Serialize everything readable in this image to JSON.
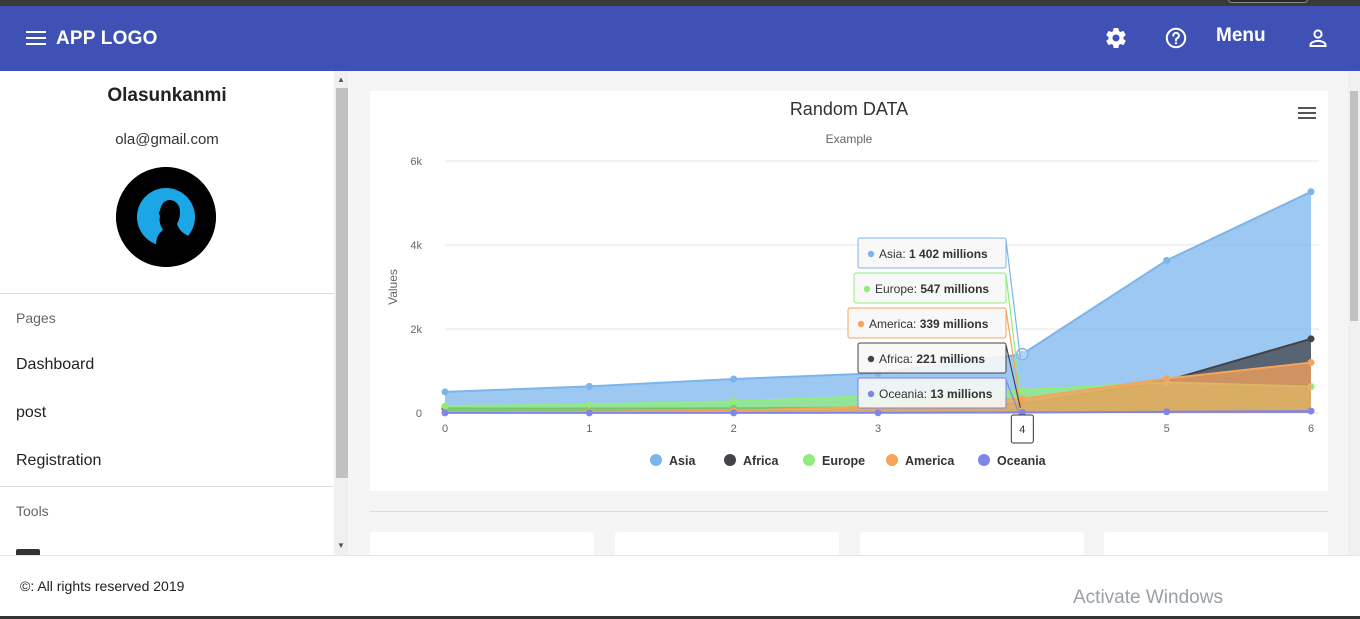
{
  "appbar": {
    "logo": "APP LOGO",
    "menu_label": "Menu",
    "icons": [
      "menu-icon",
      "gear-icon",
      "help-icon",
      "user-icon"
    ],
    "color": "#3f51b5"
  },
  "sidebar": {
    "user_name": "Olasunkanmi",
    "user_email": "ola@gmail.com",
    "sections": {
      "pages_title": "Pages",
      "pages": [
        {
          "label": "Dashboard"
        },
        {
          "label": "post"
        },
        {
          "label": "Registration"
        }
      ],
      "tools_title": "Tools"
    }
  },
  "chart_data": {
    "type": "area",
    "title": "Random DATA",
    "subtitle": "Example",
    "ylabel": "Values",
    "x": [
      0,
      1,
      2,
      3,
      4,
      5,
      6
    ],
    "ylim": [
      0,
      6000
    ],
    "yticks": [
      0,
      2000,
      4000,
      6000
    ],
    "ytick_labels": [
      "0",
      "2k",
      "4k",
      "6k"
    ],
    "grid": true,
    "legend_position": "bottom",
    "series": [
      {
        "name": "Asia",
        "color": "#7cb5ec",
        "values": [
          502,
          635,
          809,
          947,
          1402,
          3634,
          5268
        ]
      },
      {
        "name": "Africa",
        "color": "#434348",
        "values": [
          106,
          107,
          111,
          133,
          221,
          767,
          1766
        ]
      },
      {
        "name": "Europe",
        "color": "#90ed7d",
        "values": [
          163,
          203,
          276,
          408,
          547,
          729,
          628
        ]
      },
      {
        "name": "America",
        "color": "#f7a35c",
        "values": [
          18,
          31,
          54,
          156,
          339,
          818,
          1201
        ]
      },
      {
        "name": "Oceania",
        "color": "#8085e9",
        "values": [
          2,
          2,
          2,
          6,
          13,
          30,
          46
        ]
      }
    ],
    "tooltip": {
      "x": "4",
      "rows": [
        {
          "name": "Asia",
          "color": "#7cb5ec",
          "value": "1 402 millions"
        },
        {
          "name": "Europe",
          "color": "#90ed7d",
          "value": "547 millions"
        },
        {
          "name": "America",
          "color": "#f7a35c",
          "value": "339 millions"
        },
        {
          "name": "Africa",
          "color": "#434348",
          "value": "221 millions"
        },
        {
          "name": "Oceania",
          "color": "#8085e9",
          "value": "13 millions"
        }
      ]
    }
  },
  "footer": {
    "copyright": "©: All rights reserved 2019"
  },
  "os_watermark": {
    "title": "Activate Windows"
  }
}
